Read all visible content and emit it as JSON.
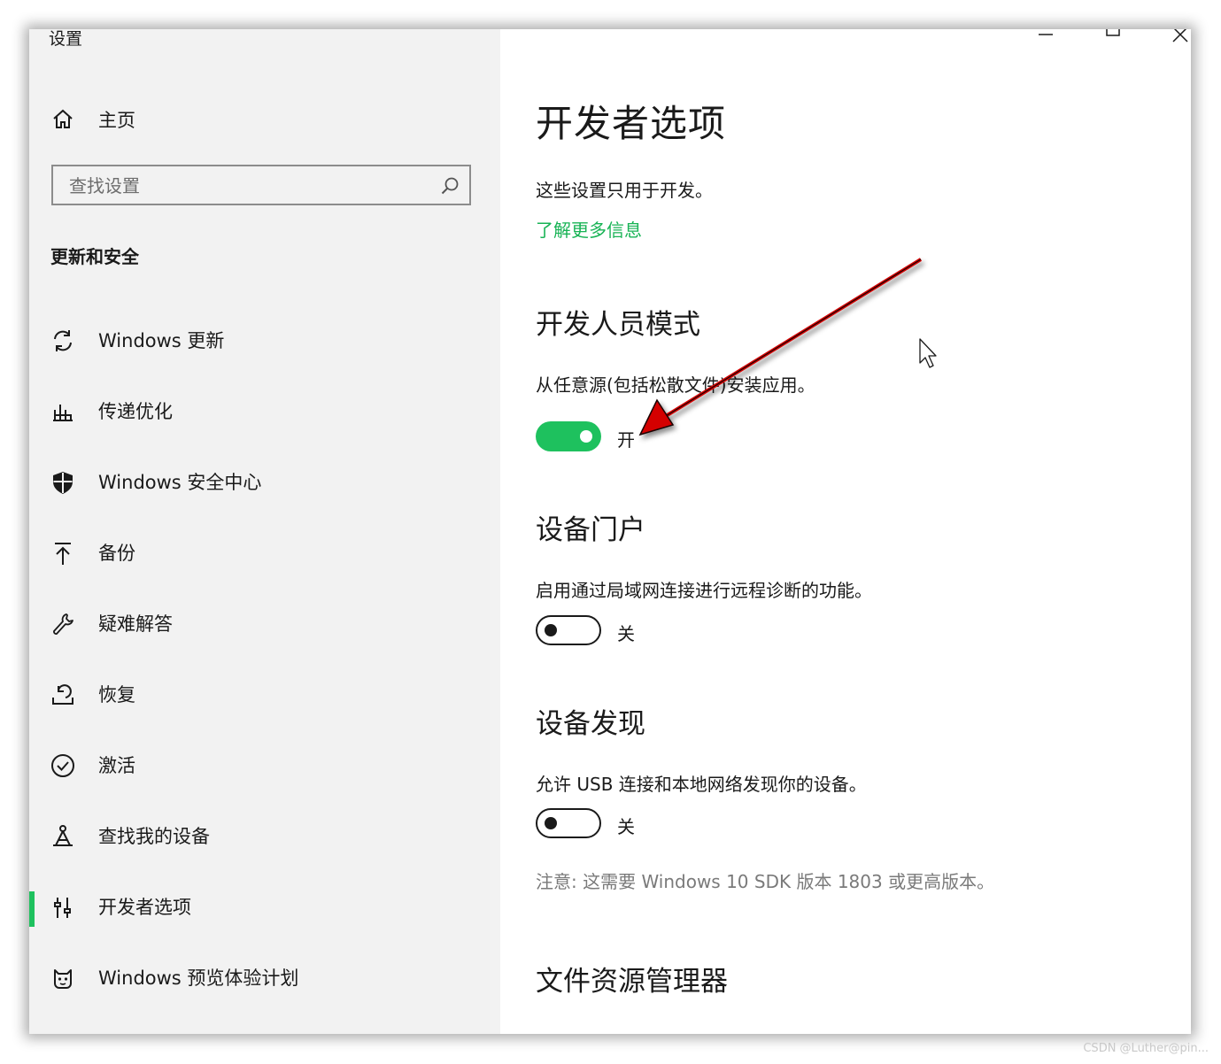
{
  "window": {
    "app_title": "设置"
  },
  "sidebar": {
    "home_label": "主页",
    "search_placeholder": "查找设置",
    "section_title": "更新和安全",
    "items": [
      {
        "label": "Windows 更新",
        "icon": "refresh-icon"
      },
      {
        "label": "传递优化",
        "icon": "delivery-icon"
      },
      {
        "label": "Windows 安全中心",
        "icon": "shield-icon"
      },
      {
        "label": "备份",
        "icon": "backup-arrow-icon"
      },
      {
        "label": "疑难解答",
        "icon": "wrench-icon"
      },
      {
        "label": "恢复",
        "icon": "recovery-icon"
      },
      {
        "label": "激活",
        "icon": "check-circle-icon"
      },
      {
        "label": "查找我的设备",
        "icon": "find-device-icon"
      },
      {
        "label": "开发者选项",
        "icon": "developer-icon",
        "active": true
      },
      {
        "label": "Windows 预览体验计划",
        "icon": "insider-cat-icon"
      }
    ]
  },
  "main": {
    "title": "开发者选项",
    "description": "这些设置只用于开发。",
    "learn_more": "了解更多信息",
    "developer_mode": {
      "heading": "开发人员模式",
      "description": "从任意源(包括松散文件)安装应用。",
      "state": "开",
      "on": true
    },
    "device_portal": {
      "heading": "设备门户",
      "description": "启用通过局域网连接进行远程诊断的功能。",
      "state": "关",
      "on": false
    },
    "device_discovery": {
      "heading": "设备发现",
      "description": "允许 USB 连接和本地网络发现你的设备。",
      "state": "关",
      "on": false,
      "note": "注意: 这需要 Windows 10 SDK 版本 1803 或更高版本。"
    },
    "file_explorer": {
      "heading": "文件资源管理器"
    }
  },
  "colors": {
    "accent": "#1ec15e",
    "link": "#18b355",
    "sidebar_bg": "#f2f2f2",
    "annotation_arrow": "#d40000"
  },
  "watermark": "CSDN @Luther@pin..."
}
